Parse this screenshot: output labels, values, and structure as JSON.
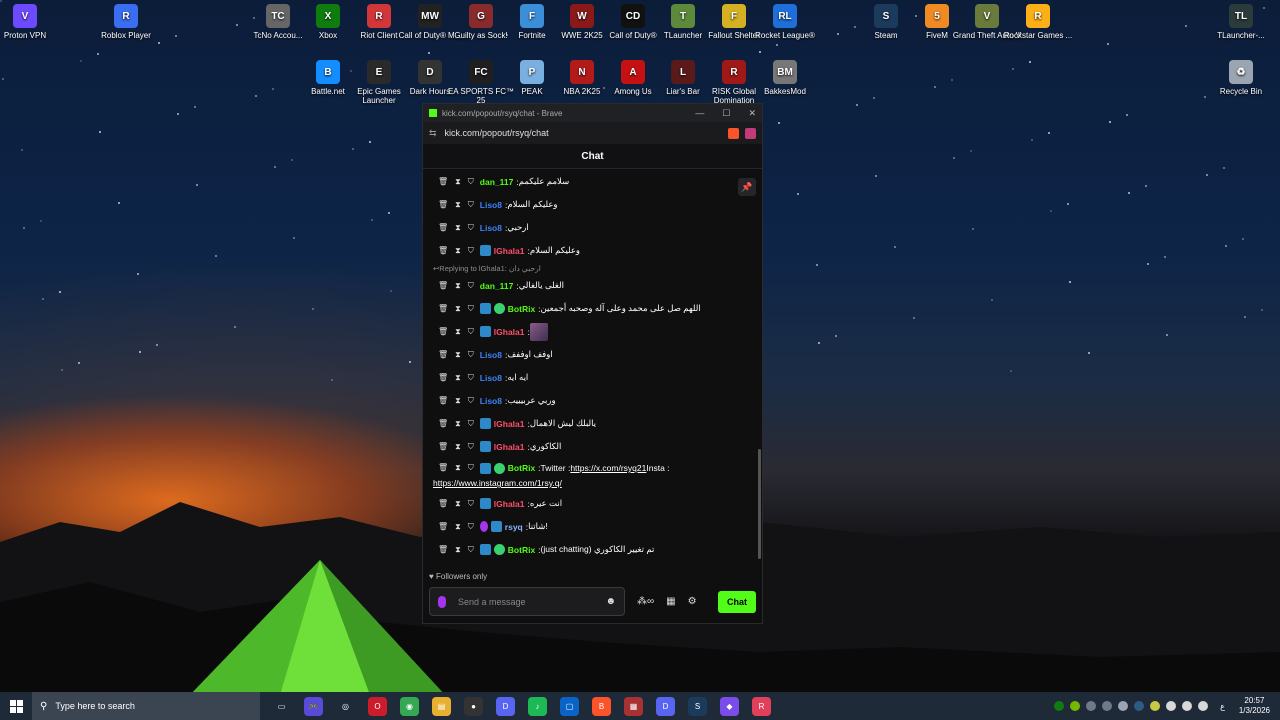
{
  "desktop": {
    "icons": [
      {
        "label": "Proton VPN",
        "color": "#6d4aff",
        "glyph": "V"
      },
      {
        "label": "Roblox Player",
        "color": "#3a6df0",
        "glyph": "R"
      },
      {
        "label": "TcNo Accou...",
        "color": "#666666",
        "glyph": "TC"
      },
      {
        "label": "Xbox",
        "color": "#107c10",
        "glyph": "X"
      },
      {
        "label": "Riot Client",
        "color": "#d13639",
        "glyph": "R"
      },
      {
        "label": "Call of Duty® M...",
        "color": "#222222",
        "glyph": "MW"
      },
      {
        "label": "Guilty as Sock!",
        "color": "#8a2b2b",
        "glyph": "G"
      },
      {
        "label": "Fortnite",
        "color": "#3a8fd8",
        "glyph": "F"
      },
      {
        "label": "WWE 2K25",
        "color": "#8a1a1a",
        "glyph": "W"
      },
      {
        "label": "Call of Duty®",
        "color": "#111111",
        "glyph": "CD"
      },
      {
        "label": "TLauncher",
        "color": "#5c8a3a",
        "glyph": "T"
      },
      {
        "label": "Fallout Shelter",
        "color": "#d4b022",
        "glyph": "F"
      },
      {
        "label": "Rocket League®",
        "color": "#1e6fd9",
        "glyph": "RL"
      },
      {
        "label": "Steam",
        "color": "#1b3a5c",
        "glyph": "S"
      },
      {
        "label": "FiveM",
        "color": "#f08a24",
        "glyph": "5"
      },
      {
        "label": "Grand Theft Auto V",
        "color": "#6a7a3a",
        "glyph": "V"
      },
      {
        "label": "Rockstar Games ...",
        "color": "#fcaf17",
        "glyph": "R"
      },
      {
        "label": "TLauncher-...",
        "color": "#2b3a3a",
        "glyph": "TL"
      },
      {
        "label": "Battle.net",
        "color": "#148eff",
        "glyph": "B"
      },
      {
        "label": "Epic Games Launcher",
        "color": "#2a2a2a",
        "glyph": "E"
      },
      {
        "label": "Dark Hours",
        "color": "#333333",
        "glyph": "D"
      },
      {
        "label": "EA SPORTS FC™ 25",
        "color": "#1f1f1f",
        "glyph": "FC"
      },
      {
        "label": "PEAK",
        "color": "#7ab0e0",
        "glyph": "P"
      },
      {
        "label": "NBA 2K25",
        "color": "#b31b1b",
        "glyph": "N"
      },
      {
        "label": "Among Us",
        "color": "#c51111",
        "glyph": "A"
      },
      {
        "label": "Liar's Bar",
        "color": "#5a1a1a",
        "glyph": "L"
      },
      {
        "label": "RISK Global Domination",
        "color": "#a01818",
        "glyph": "R"
      },
      {
        "label": "BakkesMod",
        "color": "#777777",
        "glyph": "BM"
      },
      {
        "label": "Recycle Bin",
        "color": "#9aa5b1",
        "glyph": "♻"
      }
    ]
  },
  "browser": {
    "title": "kick.com/popout/rsyq/chat - Brave",
    "url": "kick.com/popout/rsyq/chat",
    "chat_header": "Chat"
  },
  "chat": {
    "messages": [
      {
        "user": "dan_117",
        "color": "#53fc18",
        "text": "سلامم عليكمم",
        "badges": []
      },
      {
        "user": "Liso8",
        "color": "#3b82f6",
        "text": "وعليكم السلام",
        "badges": []
      },
      {
        "user": "Liso8",
        "color": "#3b82f6",
        "text": "ارحبي",
        "badges": []
      },
      {
        "user": "lGhala1",
        "color": "#ff4f6b",
        "text": "وعليكم السلام",
        "badges": [
          "blue"
        ]
      },
      {
        "reply": "Replying to lGhala1: ارحبي دان"
      },
      {
        "user": "dan_117",
        "color": "#53fc18",
        "text": "الغلى يالغالي",
        "badges": []
      },
      {
        "user": "BotRix",
        "color": "#53fc18",
        "text": "اللهم صل على محمد وعلى آله وصحبه أجمعين",
        "badges": [
          "blue",
          "green"
        ]
      },
      {
        "user": "lGhala1",
        "color": "#ff4f6b",
        "text": "",
        "badges": [
          "blue"
        ],
        "emote": true
      },
      {
        "user": "Liso8",
        "color": "#3b82f6",
        "text": "اوفف اوففف",
        "badges": []
      },
      {
        "user": "Liso8",
        "color": "#3b82f6",
        "text": "ايه ايه",
        "badges": []
      },
      {
        "user": "Liso8",
        "color": "#3b82f6",
        "text": "وربي عربيييب",
        "badges": []
      },
      {
        "user": "lGhala1",
        "color": "#ff4f6b",
        "text": "يالبلك ليش الاهمال",
        "badges": [
          "blue"
        ]
      },
      {
        "user": "lGhala1",
        "color": "#ff4f6b",
        "text": "الكاكوري",
        "badges": [
          "blue"
        ]
      },
      {
        "user": "BotRix",
        "color": "#53fc18",
        "text": "Twitter : ",
        "link1": "https://x.com/rsyq21",
        "text2": " Insta :",
        "link2": "https://www.instagram.com/1rsy.q/",
        "badges": [
          "blue",
          "green"
        ],
        "tall": true
      },
      {
        "user": "lGhala1",
        "color": "#ff4f6b",
        "text": "انت عيره",
        "badges": [
          "blue"
        ]
      },
      {
        "user": "rsyq",
        "color": "#8ab4f8",
        "text": "شاتنا!",
        "badges": [
          "purple",
          "blue"
        ]
      },
      {
        "user": "BotRix",
        "color": "#53fc18",
        "text": "(just chatting) تم تغيير الكاكوري",
        "badges": [
          "blue",
          "green"
        ]
      }
    ],
    "followers_only": "Followers only",
    "input_placeholder": "Send a message",
    "send_label": "Chat"
  },
  "taskbar": {
    "search_placeholder": "Type here to search",
    "time": "20:57",
    "date": "1/3/2026",
    "lang": "ع",
    "apps": [
      {
        "name": "task-view",
        "color": "#1f2a38",
        "glyph": "▭"
      },
      {
        "name": "controller",
        "color": "#5a4ad8",
        "glyph": "🎮"
      },
      {
        "name": "steam",
        "color": "#1f2a38",
        "glyph": "◎"
      },
      {
        "name": "opera",
        "color": "#cc1b2b",
        "glyph": "O"
      },
      {
        "name": "chrome",
        "color": "#34a853",
        "glyph": "◉"
      },
      {
        "name": "file-explorer",
        "color": "#e8b030",
        "glyph": "▤"
      },
      {
        "name": "obs",
        "color": "#333333",
        "glyph": "●"
      },
      {
        "name": "discord-ptb",
        "color": "#5865f2",
        "glyph": "D"
      },
      {
        "name": "spotify",
        "color": "#1db954",
        "glyph": "♪"
      },
      {
        "name": "app-blue",
        "color": "#0a64c8",
        "glyph": "▢"
      },
      {
        "name": "brave",
        "color": "#fb542b",
        "glyph": "B"
      },
      {
        "name": "app-tiles",
        "color": "#a83232",
        "glyph": "▦"
      },
      {
        "name": "discord",
        "color": "#5865f2",
        "glyph": "D"
      },
      {
        "name": "steam-2",
        "color": "#1b3a5c",
        "glyph": "S"
      },
      {
        "name": "app-purple",
        "color": "#7b4de8",
        "glyph": "◆"
      },
      {
        "name": "app-red",
        "color": "#e0405a",
        "glyph": "R"
      }
    ]
  }
}
